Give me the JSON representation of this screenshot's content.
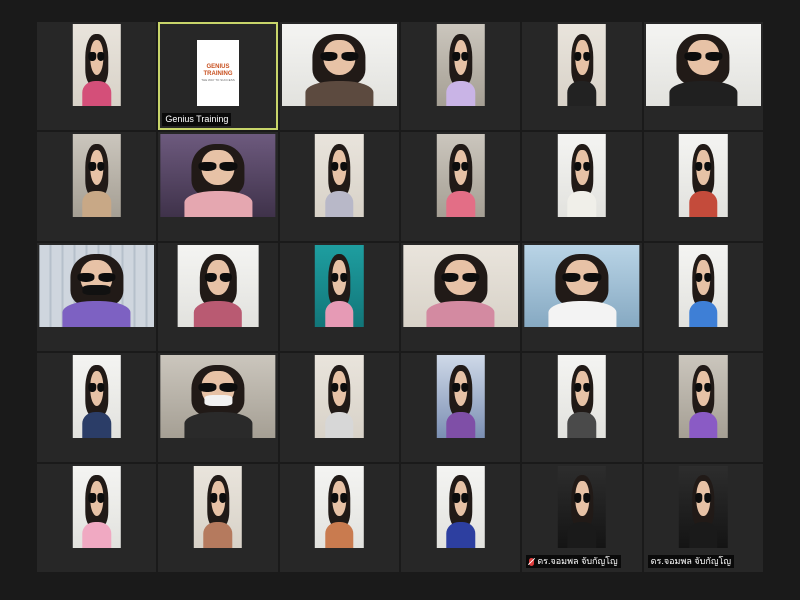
{
  "meeting": {
    "layout": "gallery-view",
    "columns": 6,
    "rows": 5,
    "active_speaker_color": "#c8d56a",
    "participants": [
      {
        "name": "",
        "bg": "bg-wall",
        "shirt": "#d44f79"
      },
      {
        "name": "Genius Training",
        "logo_text": "GENIUS TRAINING",
        "logo_sub": "THE WAY TO SUCCESS",
        "is_logo": true
      },
      {
        "name": "",
        "bg": "bg-white",
        "shirt": "#5c4a3f"
      },
      {
        "name": "",
        "bg": "bg-room",
        "shirt": "#c9b4e6"
      },
      {
        "name": "",
        "bg": "bg-wall",
        "shirt": "#222222"
      },
      {
        "name": "",
        "bg": "bg-white",
        "shirt": "#202020"
      },
      {
        "name": "",
        "bg": "bg-room",
        "shirt": "#c8a886"
      },
      {
        "name": "",
        "bg": "bg-purple",
        "shirt": "#e5a7b0"
      },
      {
        "name": "",
        "bg": "bg-wall",
        "shirt": "#b8b8c8"
      },
      {
        "name": "",
        "bg": "bg-room",
        "shirt": "#e36e86"
      },
      {
        "name": "",
        "bg": "bg-white",
        "shirt": "#f0efe9"
      },
      {
        "name": "",
        "bg": "bg-white",
        "shirt": "#c44b3b"
      },
      {
        "name": "",
        "bg": "bg-board",
        "shirt": "#7d61c2"
      },
      {
        "name": "",
        "bg": "bg-white",
        "shirt": "#b95a72"
      },
      {
        "name": "",
        "bg": "bg-teal",
        "shirt": "#e69ab5"
      },
      {
        "name": "",
        "bg": "bg-wall",
        "shirt": "#d38aa1"
      },
      {
        "name": "",
        "bg": "bg-blue",
        "shirt": "#f3f3f3"
      },
      {
        "name": "",
        "bg": "bg-white",
        "shirt": "#3e7fd6"
      },
      {
        "name": "",
        "bg": "bg-white",
        "shirt": "#2b3d67"
      },
      {
        "name": "",
        "bg": "bg-room",
        "shirt": "#2a2a2a"
      },
      {
        "name": "",
        "bg": "bg-wall",
        "shirt": "#d7d7d7"
      },
      {
        "name": "",
        "bg": "bg-street",
        "shirt": "#7f4fa7"
      },
      {
        "name": "",
        "bg": "bg-white",
        "shirt": "#4a4a4a"
      },
      {
        "name": "",
        "bg": "bg-room",
        "shirt": "#8a5bc5"
      },
      {
        "name": "",
        "bg": "bg-white",
        "shirt": "#f0a9c2"
      },
      {
        "name": "",
        "bg": "bg-wall",
        "shirt": "#b57a5e"
      },
      {
        "name": "",
        "bg": "bg-white",
        "shirt": "#c97b4f"
      },
      {
        "name": "",
        "bg": "bg-white",
        "shirt": "#2d3fa0"
      },
      {
        "name": "ดร.จอมพล จับกัญโญ",
        "bg": "bg-dark",
        "shirt": "#1a1a1a",
        "mic_muted": true
      },
      {
        "name": "ดร.จอมพล จับกัญโญ",
        "bg": "bg-dark",
        "shirt": "#1a1a1a",
        "mic_muted": false
      }
    ]
  }
}
